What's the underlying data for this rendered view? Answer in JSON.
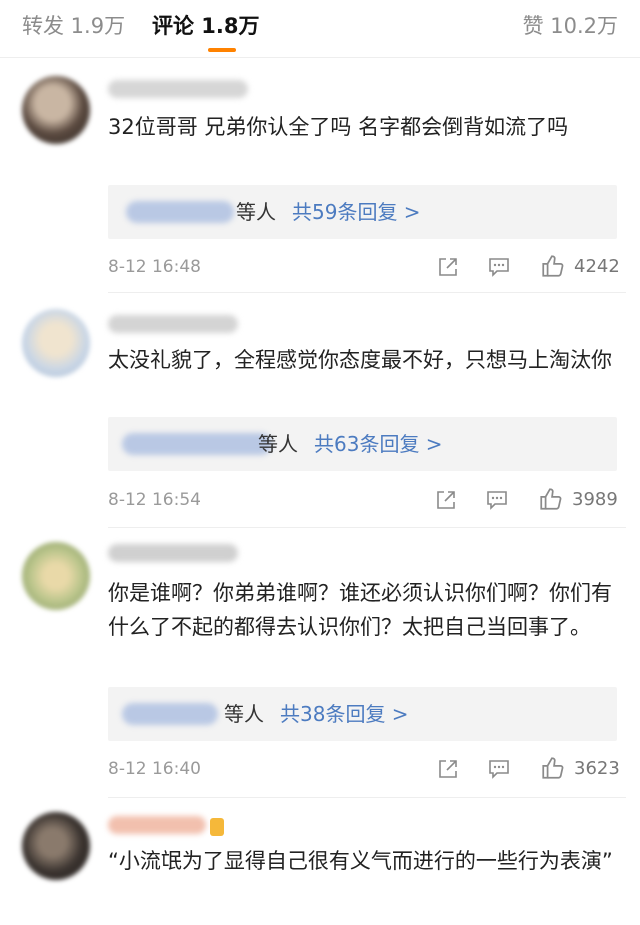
{
  "tabs": {
    "repost": "转发 1.9万",
    "comments": "评论 1.8万",
    "likes": "赞 10.2万"
  },
  "comments": [
    {
      "text": "32位哥哥 兄弟你认全了吗 名字都会倒背如流了吗",
      "reply_names_suffix": "等人",
      "reply_count": "共59条回复 >",
      "time": "8-12 16:48",
      "likes": "4242"
    },
    {
      "text": "太没礼貌了，全程感觉你态度最不好，只想马上淘汰你",
      "reply_names_suffix": "等人",
      "reply_count": "共63条回复 >",
      "time": "8-12 16:54",
      "likes": "3989"
    },
    {
      "text": "你是谁啊？你弟弟谁啊？谁还必须认识你们啊？你们有什么了不起的都得去认识你们？太把自己当回事了。",
      "reply_names_suffix": "等人",
      "reply_count": "共38条回复 >",
      "time": "8-12 16:40",
      "likes": "3623"
    },
    {
      "text": "“小流氓为了显得自己很有义气而进行的一些行为表演”"
    }
  ],
  "colors": {
    "accent": "#ff8200",
    "link": "#4c7bc0",
    "reply_bg": "#f3f3f3"
  },
  "icons": [
    "share-icon",
    "comment-icon",
    "like-icon"
  ]
}
